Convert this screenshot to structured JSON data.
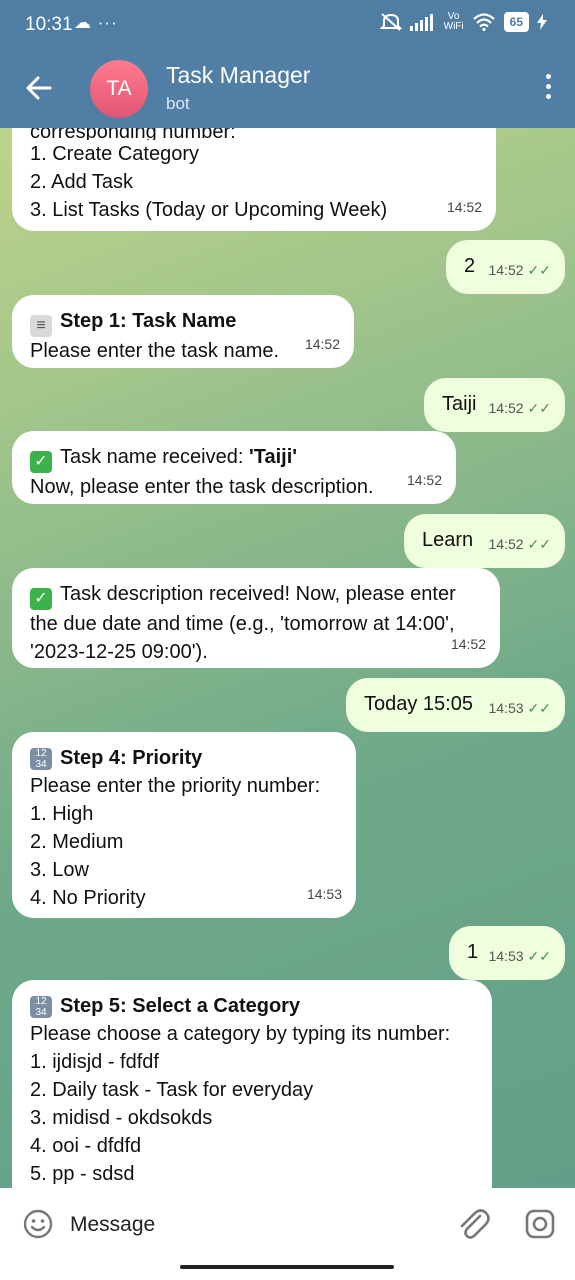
{
  "status": {
    "time": "10:31",
    "left_icons": "☁ ···",
    "signal": "📶",
    "vowifi_line1": "Vo",
    "vowifi_line2": "WiFi",
    "battery": "65"
  },
  "header": {
    "avatar_initials": "TA",
    "title": "Task Manager",
    "subtitle": "bot"
  },
  "messages": {
    "m1": {
      "lines": [
        "corresponding number:",
        "1. Create Category",
        "2. Add Task",
        "3. List Tasks (Today or Upcoming Week)"
      ],
      "time": "14:52"
    },
    "m2": {
      "text": "2",
      "time": "14:52",
      "ticks": "✓✓"
    },
    "m3": {
      "title": "Step 1: Task Name",
      "body": "Please enter the task name.",
      "time": "14:52"
    },
    "m4": {
      "text": "Taiji",
      "time": "14:52",
      "ticks": "✓✓"
    },
    "m5": {
      "prefix": "Task name received: ",
      "quoted": "'Taiji'",
      "line2": "Now, please enter the task description.",
      "time": "14:52"
    },
    "m6": {
      "text": "Learn",
      "time": "14:52",
      "ticks": "✓✓"
    },
    "m7": {
      "line1": "Task description received! Now, please enter",
      "line2": "the due date and time (e.g., 'tomorrow at 14:00',",
      "line3": "'2023-12-25 09:00').",
      "time": "14:52"
    },
    "m8": {
      "text": "Today 15:05",
      "time": "14:53",
      "ticks": "✓✓"
    },
    "m9": {
      "title": "Step 4: Priority",
      "lines": [
        "Please enter the priority number:",
        "1. High",
        "2. Medium",
        "3. Low",
        "4. No Priority"
      ],
      "time": "14:53"
    },
    "m10": {
      "text": "1",
      "time": "14:53",
      "ticks": "✓✓"
    },
    "m11": {
      "title": "Step 5: Select a Category",
      "lines": [
        "Please choose a category by typing its number:",
        "1. ijdisjd - fdfdf",
        "2. Daily task - Task for everyday",
        "3. midisd - okdsokds",
        "4. ooi - dfdfd",
        "5. pp - sdsd"
      ]
    }
  },
  "icons": {
    "check_emoji": "✓",
    "num_emoji_top": "12",
    "num_emoji_bottom": "34",
    "page_emoji": "≡"
  },
  "input": {
    "placeholder": "Message"
  }
}
